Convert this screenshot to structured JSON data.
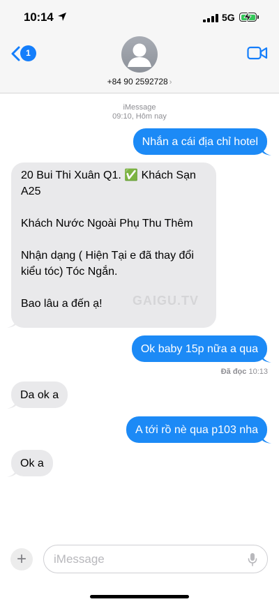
{
  "status_bar": {
    "time": "10:14",
    "network": "5G",
    "icons": [
      "location-arrow-icon",
      "signal-bars-icon",
      "battery-charging-icon"
    ],
    "battery_color": "#34c759"
  },
  "header": {
    "back_badge": "1",
    "contact_name": "+84 90 2592728",
    "chevron": "›",
    "icons": [
      "chevron-left-icon",
      "person-avatar-icon",
      "video-camera-icon"
    ],
    "accent_color": "#147efb"
  },
  "thread": {
    "service": "iMessage",
    "timestamp": "09:10, Hôm nay",
    "messages": [
      {
        "direction": "sent",
        "lines": [
          "Nhắn a cái địa chỉ hotel"
        ]
      },
      {
        "direction": "received",
        "lines": [
          "20 Bui Thi Xuân Q1. ✅ Khách Sạn",
          "A25",
          "",
          "Khách Nước Ngoài Phụ Thu Thêm",
          "",
          "Nhận dạng ( Hiện Tại e đã thay đổi",
          "kiểu tóc) Tóc Ngắn.",
          "",
          "Bao lâu a đến ạ!"
        ]
      },
      {
        "direction": "sent",
        "lines": [
          "Ok baby 15p nữa a qua"
        ]
      },
      {
        "direction": "received",
        "lines": [
          "Da ok a"
        ]
      },
      {
        "direction": "sent",
        "lines": [
          "A tới rồ nè qua p103 nha"
        ]
      },
      {
        "direction": "received",
        "lines": [
          "Ok a"
        ]
      }
    ],
    "read_receipt": {
      "label": "Đã đọc",
      "time": "10:13"
    },
    "watermark": "GAIGU.TV",
    "sent_color": "#1c8af6",
    "received_color": "#e9e9eb"
  },
  "composer": {
    "placeholder": "iMessage",
    "value": "",
    "plus_label": "+",
    "icons": [
      "plus-icon",
      "microphone-icon"
    ]
  }
}
